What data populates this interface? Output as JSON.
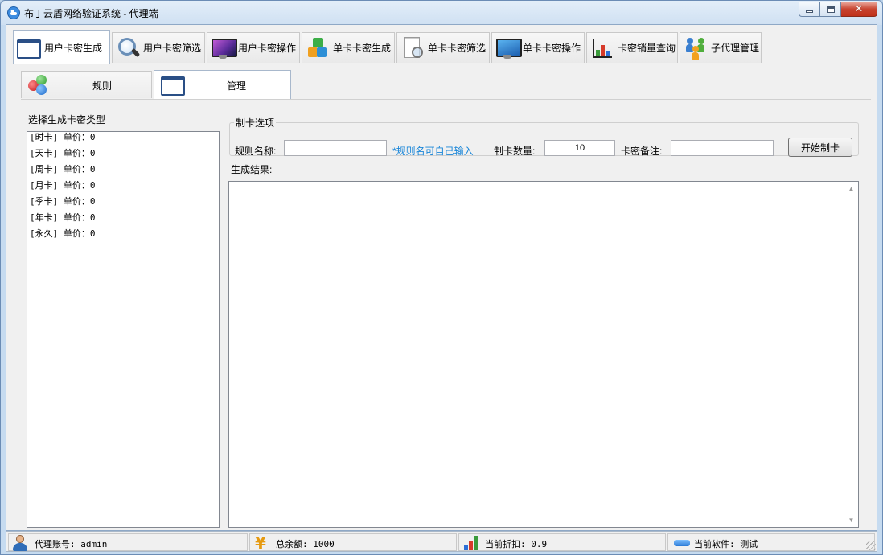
{
  "window": {
    "title": "布丁云盾网络验证系统 - 代理端"
  },
  "top_tabs": [
    {
      "label": "用户卡密生成",
      "icon": "window-icon",
      "active": true
    },
    {
      "label": "用户卡密筛选",
      "icon": "magnifier-icon",
      "active": false
    },
    {
      "label": "用户卡密操作",
      "icon": "monitor-icon",
      "active": false
    },
    {
      "label": "单卡卡密生成",
      "icon": "blocks-icon",
      "active": false
    },
    {
      "label": "单卡卡密筛选",
      "icon": "document-search-icon",
      "active": false
    },
    {
      "label": "单卡卡密操作",
      "icon": "monitor-icon",
      "active": false
    },
    {
      "label": "卡密销量查询",
      "icon": "bar-chart-icon",
      "active": false
    },
    {
      "label": "子代理管理",
      "icon": "people-icon",
      "active": false
    }
  ],
  "sub_tabs": [
    {
      "label": "规则",
      "icon": "balls-icon",
      "active": false
    },
    {
      "label": "管理",
      "icon": "window-icon",
      "active": true
    }
  ],
  "card_list": {
    "label": "选择生成卡密类型",
    "items": [
      "[时卡] 单价：0",
      "[天卡] 单价：0",
      "[周卡] 单价：0",
      "[月卡] 单价：0",
      "[季卡] 单价：0",
      "[年卡] 单价：0",
      "[永久] 单价：0"
    ]
  },
  "options": {
    "group_title": "制卡选项",
    "rule_name_label": "规则名称:",
    "rule_name_value": "",
    "rule_hint": "*规则名可自己输入",
    "count_label": "制卡数量:",
    "count_value": "10",
    "remark_label": "卡密备注:",
    "remark_value": "",
    "start_button": "开始制卡"
  },
  "result": {
    "label": "生成结果:",
    "content": ""
  },
  "status": {
    "account": "代理账号: admin",
    "balance": "总余额: 1000",
    "discount": "当前折扣: 0.9",
    "software": "当前软件: 测试"
  },
  "colors": {
    "hint": "#1a86d8",
    "title_gradient_top": "#e3eef9",
    "close_button": "#c7432f"
  }
}
